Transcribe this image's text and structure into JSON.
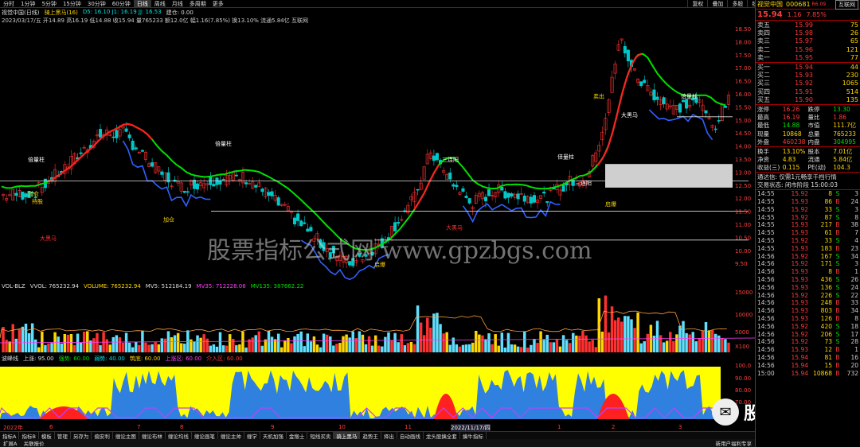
{
  "topbar": {
    "tabs": [
      "分时",
      "1分钟",
      "5分钟",
      "15分钟",
      "30分钟",
      "60分钟",
      "日线",
      "周线",
      "月线",
      "多周期",
      "更多"
    ],
    "active_tab": "日线",
    "right": [
      "复权",
      "叠加",
      "多股",
      "统计",
      "画线",
      "F10",
      "标记",
      "自设",
      "□"
    ]
  },
  "symbol": {
    "name": "视觉中国(日线)",
    "indicator": "骑上黑马(16)",
    "params": "D5: 16.10  J1: 16.19  JJ: 16.53",
    "extra": "建仓: 0.00"
  },
  "info_line": "2023/03/17/五 开14.89 高16.19 低14.88 收15.94 量765233 额12.0亿 幅1.16(7.85%) 换13.10% 流通5.84亿 互联网",
  "watermark": "股票指标公式网 www.gpzbgs.com",
  "price_axis": [
    "18.50",
    "18.00",
    "17.50",
    "17.00",
    "16.50",
    "16.00",
    "15.50",
    "15.00",
    "14.50",
    "14.00",
    "13.50",
    "13.00",
    "12.50",
    "12.00",
    "11.50",
    "11.00",
    "10.50",
    "10.00",
    "9.50"
  ],
  "vol_axis": [
    "15000",
    "10000",
    "5000",
    "X100"
  ],
  "ind3_axis": [
    "100.0",
    "90.00",
    "80.00",
    "70.00"
  ],
  "vol_header": {
    "name": "VOL-BLZ",
    "vvol": "VVOL: 765232.94",
    "volume": "VOLUME: 765232.94",
    "mv5": "MV5: 512184.19",
    "mv35": "MV35: 712228.06",
    "mv135": "MV135: 387662.22"
  },
  "ind3_header": {
    "name": "波峰线",
    "p1": "上涨: 95.00",
    "p2": "强势: 60.00",
    "p3": "弱势: 40.00",
    "p4": "筑底: 60.00",
    "p5": "上涨区: 60.00",
    "p6": "介入区: 60.00"
  },
  "date_labels": [
    "2022年",
    "6",
    "7",
    "8",
    "9",
    "10",
    "11",
    "2022/11/17/四",
    "1",
    "2",
    "3"
  ],
  "fn_tabs": [
    "指标A",
    "指标B",
    "模板",
    "管理",
    "另存为",
    "偏安利",
    "缠论主图",
    "缠论布林",
    "缠论均线",
    "缠论画笔",
    "缠论主帅",
    "缠学",
    "天机加强",
    "金猴士",
    "短线买卖",
    "骑上黑马",
    "趋势王",
    "择出",
    "自动画线",
    "龙头股擒全套",
    "擒牛指标"
  ],
  "fn_active": "骑上黑马",
  "bottom_tabs": [
    "扩展A",
    "关联报价"
  ],
  "bottom_right": "新用户福利专享",
  "chart_labels": {
    "bear": "大黑马",
    "hold": "持股",
    "start": "启爆",
    "boom": "加仓",
    "wave": "倍量柱",
    "buy": "三连阳",
    "sell": "卖出"
  },
  "rp": {
    "title": "视觉中国",
    "code": "000681",
    "tag": "互联网",
    "price": "15.94",
    "chg": "1.16",
    "pct": "7.85%",
    "rate_label": "R6.09",
    "sells": [
      {
        "l": "卖五",
        "p": "15.99",
        "v": "75"
      },
      {
        "l": "卖四",
        "p": "15.98",
        "v": "26"
      },
      {
        "l": "卖三",
        "p": "15.97",
        "v": "65"
      },
      {
        "l": "卖二",
        "p": "15.96",
        "v": "121"
      },
      {
        "l": "卖一",
        "p": "15.95",
        "v": "77"
      }
    ],
    "buys": [
      {
        "l": "买一",
        "p": "15.94",
        "v": "44"
      },
      {
        "l": "买二",
        "p": "15.93",
        "v": "230"
      },
      {
        "l": "买三",
        "p": "15.92",
        "v": "1065"
      },
      {
        "l": "买四",
        "p": "15.91",
        "v": "514"
      },
      {
        "l": "买五",
        "p": "15.90",
        "v": "135"
      }
    ],
    "stats": [
      [
        "涨停",
        "16.26",
        "跌停",
        "13.30"
      ],
      [
        "最高",
        "16.19",
        "量比",
        "1.86"
      ],
      [
        "最低",
        "14.88",
        "市值",
        "111.7亿"
      ],
      [
        "现量",
        "10868",
        "总量",
        "765233"
      ],
      [
        "外盘",
        "460238",
        "内盘",
        "304995"
      ]
    ],
    "stats2": [
      [
        "换手",
        "13.10%",
        "股本",
        "7.01亿"
      ],
      [
        "净资",
        "4.83",
        "流通",
        "5.84亿"
      ],
      [
        "收益(三)",
        "0.115",
        "PE(动)",
        "104.3"
      ]
    ],
    "notice": "通达信: 仅需1元畅享千档行情",
    "phase": "交易状态: 闭市阶段 15:00:03",
    "ticks": [
      [
        "14:55",
        "15.92",
        "8",
        "S",
        "3"
      ],
      [
        "14:55",
        "15.93",
        "86",
        "B",
        "24"
      ],
      [
        "14:55",
        "15.92",
        "33",
        "S",
        "3"
      ],
      [
        "14:55",
        "15.92",
        "87",
        "S",
        "8"
      ],
      [
        "14:55",
        "15.93",
        "217",
        "B",
        "38"
      ],
      [
        "14:55",
        "15.93",
        "61",
        "B",
        "7"
      ],
      [
        "14:55",
        "15.92",
        "33",
        "S",
        "4"
      ],
      [
        "14:55",
        "15.93",
        "183",
        "B",
        "23"
      ],
      [
        "14:56",
        "15.92",
        "167",
        "S",
        "34"
      ],
      [
        "14:56",
        "15.92",
        "171",
        "S",
        "3"
      ],
      [
        "14:56",
        "15.93",
        "8",
        "B",
        "1"
      ],
      [
        "14:56",
        "15.93",
        "436",
        "S",
        "26"
      ],
      [
        "14:56",
        "15.93",
        "136",
        "S",
        "24"
      ],
      [
        "14:56",
        "15.92",
        "226",
        "S",
        "22"
      ],
      [
        "14:56",
        "15.93",
        "248",
        "B",
        "33"
      ],
      [
        "14:56",
        "15.93",
        "803",
        "B",
        "34"
      ],
      [
        "14:56",
        "15.93",
        "126",
        "B",
        "8"
      ],
      [
        "14:56",
        "15.92",
        "420",
        "S",
        "18"
      ],
      [
        "14:56",
        "15.92",
        "206",
        "S",
        "17"
      ],
      [
        "14:56",
        "15.92",
        "73",
        "S",
        "28"
      ],
      [
        "14:56",
        "15.93",
        "12",
        "B",
        "1"
      ],
      [
        "14:56",
        "15.94",
        "81",
        "B",
        "16"
      ],
      [
        "14:56",
        "15.94",
        "15",
        "B",
        "20"
      ],
      [
        "15:00",
        "15.94",
        "10868",
        "B",
        "732"
      ]
    ]
  }
}
